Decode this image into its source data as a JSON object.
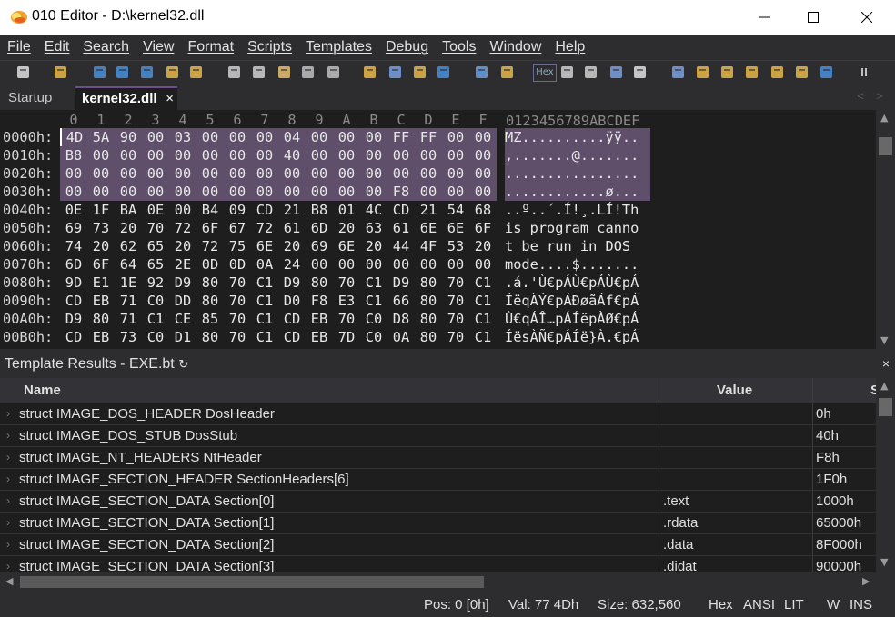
{
  "window": {
    "title": "010 Editor - D:\\kernel32.dll"
  },
  "menu": [
    "File",
    "Edit",
    "Search",
    "View",
    "Format",
    "Scripts",
    "Templates",
    "Debug",
    "Tools",
    "Window",
    "Help"
  ],
  "toolbar": {
    "hex_label": "Hex",
    "icons": [
      "new-file",
      "open-folder",
      "save",
      "save-as",
      "save-all",
      "open-recent",
      "copy-files",
      "cut",
      "copy",
      "paste",
      "undo",
      "redo",
      "find",
      "find-replace",
      "find-in-files",
      "goto",
      "run-script",
      "run-template",
      "hex-mode",
      "text-mode",
      "show-whitespace",
      "columns",
      "highlight",
      "calculator",
      "inspector",
      "compare",
      "histogram",
      "checksum",
      "operations",
      "base-converter",
      "pause"
    ]
  },
  "tabs": {
    "startup": "Startup",
    "active": "kernel32.dll",
    "close": "×",
    "nav": "< >"
  },
  "hex": {
    "col_header": "0  1  2  3  4  5  6  7  8  9  A  B  C  D  E  F",
    "char_header": "0123456789ABCDEF",
    "rows": [
      {
        "addr": "0000h:",
        "bytes": [
          "4D",
          "5A",
          "90",
          "00",
          "03",
          "00",
          "00",
          "00",
          "04",
          "00",
          "00",
          "00",
          "FF",
          "FF",
          "00",
          "00"
        ],
        "chars": "MZ..........ÿÿ..",
        "sel": true
      },
      {
        "addr": "0010h:",
        "bytes": [
          "B8",
          "00",
          "00",
          "00",
          "00",
          "00",
          "00",
          "00",
          "40",
          "00",
          "00",
          "00",
          "00",
          "00",
          "00",
          "00"
        ],
        "chars": ",.......@.......",
        "sel": true
      },
      {
        "addr": "0020h:",
        "bytes": [
          "00",
          "00",
          "00",
          "00",
          "00",
          "00",
          "00",
          "00",
          "00",
          "00",
          "00",
          "00",
          "00",
          "00",
          "00",
          "00"
        ],
        "chars": "................",
        "sel": true
      },
      {
        "addr": "0030h:",
        "bytes": [
          "00",
          "00",
          "00",
          "00",
          "00",
          "00",
          "00",
          "00",
          "00",
          "00",
          "00",
          "00",
          "F8",
          "00",
          "00",
          "00"
        ],
        "chars": "............ø...",
        "sel": true
      },
      {
        "addr": "0040h:",
        "bytes": [
          "0E",
          "1F",
          "BA",
          "0E",
          "00",
          "B4",
          "09",
          "CD",
          "21",
          "B8",
          "01",
          "4C",
          "CD",
          "21",
          "54",
          "68"
        ],
        "chars": "..º..´.Í!¸.LÍ!Th",
        "sel": false
      },
      {
        "addr": "0050h:",
        "bytes": [
          "69",
          "73",
          "20",
          "70",
          "72",
          "6F",
          "67",
          "72",
          "61",
          "6D",
          "20",
          "63",
          "61",
          "6E",
          "6E",
          "6F"
        ],
        "chars": "is program canno",
        "sel": false
      },
      {
        "addr": "0060h:",
        "bytes": [
          "74",
          "20",
          "62",
          "65",
          "20",
          "72",
          "75",
          "6E",
          "20",
          "69",
          "6E",
          "20",
          "44",
          "4F",
          "53",
          "20"
        ],
        "chars": "t be run in DOS ",
        "sel": false
      },
      {
        "addr": "0070h:",
        "bytes": [
          "6D",
          "6F",
          "64",
          "65",
          "2E",
          "0D",
          "0D",
          "0A",
          "24",
          "00",
          "00",
          "00",
          "00",
          "00",
          "00",
          "00"
        ],
        "chars": "mode....$.......",
        "sel": false
      },
      {
        "addr": "0080h:",
        "bytes": [
          "9D",
          "E1",
          "1E",
          "92",
          "D9",
          "80",
          "70",
          "C1",
          "D9",
          "80",
          "70",
          "C1",
          "D9",
          "80",
          "70",
          "C1"
        ],
        "chars": ".á.'Ù€pÁÙ€pÁÙ€pÁ",
        "sel": false
      },
      {
        "addr": "0090h:",
        "bytes": [
          "CD",
          "EB",
          "71",
          "C0",
          "DD",
          "80",
          "70",
          "C1",
          "D0",
          "F8",
          "E3",
          "C1",
          "66",
          "80",
          "70",
          "C1"
        ],
        "chars": "ÍëqÀÝ€pÁÐøãÁf€pÁ",
        "sel": false
      },
      {
        "addr": "00A0h:",
        "bytes": [
          "D9",
          "80",
          "71",
          "C1",
          "CE",
          "85",
          "70",
          "C1",
          "CD",
          "EB",
          "70",
          "C0",
          "D8",
          "80",
          "70",
          "C1"
        ],
        "chars": "Ù€qÁÎ…pÁÍëpÀØ€pÁ",
        "sel": false
      },
      {
        "addr": "00B0h:",
        "bytes": [
          "CD",
          "EB",
          "73",
          "C0",
          "D1",
          "80",
          "70",
          "C1",
          "CD",
          "EB",
          "7D",
          "C0",
          "0A",
          "80",
          "70",
          "C1"
        ],
        "chars": "ÍësÀÑ€pÁÍë}À.€pÁ",
        "sel": false
      }
    ]
  },
  "template": {
    "title": "Template Results - EXE.bt",
    "refresh_icon": "↻",
    "close": "×",
    "columns": {
      "name": "Name",
      "value": "Value",
      "start": "S"
    },
    "rows": [
      {
        "name": "struct IMAGE_DOS_HEADER DosHeader",
        "value": "",
        "start": "0h"
      },
      {
        "name": "struct IMAGE_DOS_STUB DosStub",
        "value": "",
        "start": "40h"
      },
      {
        "name": "struct IMAGE_NT_HEADERS NtHeader",
        "value": "",
        "start": "F8h"
      },
      {
        "name": "struct IMAGE_SECTION_HEADER SectionHeaders[6]",
        "value": "",
        "start": "1F0h"
      },
      {
        "name": "struct IMAGE_SECTION_DATA Section[0]",
        "value": ".text",
        "start": "1000h"
      },
      {
        "name": "struct IMAGE_SECTION_DATA Section[1]",
        "value": ".rdata",
        "start": "65000h"
      },
      {
        "name": "struct IMAGE_SECTION_DATA Section[2]",
        "value": ".data",
        "start": "8F000h"
      },
      {
        "name": "struct IMAGE_SECTION_DATA Section[3]",
        "value": ".didat",
        "start": "90000h"
      }
    ]
  },
  "status": {
    "pos": "Pos: 0 [0h]",
    "val": "Val: 77 4Dh",
    "size": "Size: 632,560",
    "mode": "Hex",
    "encoding": "ANSI",
    "endian": "LIT",
    "w": "W",
    "ins": "INS"
  }
}
